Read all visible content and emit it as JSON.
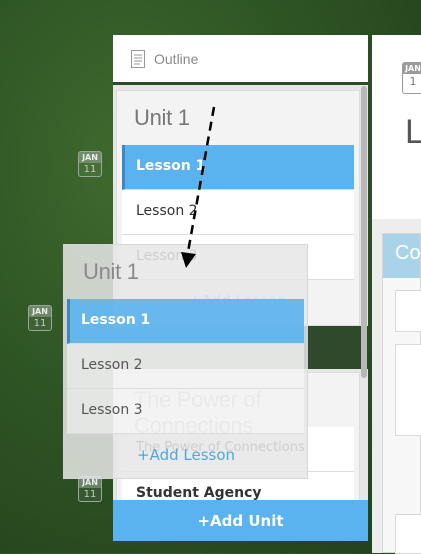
{
  "colors": {
    "accent": "#5ab3ee",
    "panel_bg": "#e6e6e6",
    "background": "#2e5424"
  },
  "date_badges": [
    {
      "month": "JAN",
      "day": "11"
    },
    {
      "month": "JAN",
      "day": "11"
    },
    {
      "month": "JAN",
      "day": "11"
    }
  ],
  "outline": {
    "icon": "document-icon",
    "header_label": "Outline",
    "units": [
      {
        "title": "Unit 1",
        "lessons": [
          "Lesson 1",
          "Lesson 2",
          "Lesson 3"
        ],
        "add_lesson_label": "+Add Lesson"
      },
      {
        "title": "The Power of Connections",
        "lessons": [
          "The Power of Connections",
          "Student Agency"
        ]
      }
    ],
    "add_unit_label": "+Add Unit"
  },
  "dragged_unit": {
    "title": "Unit 1",
    "lessons": [
      "Lesson 1",
      "Lesson 2",
      "Lesson 3"
    ],
    "add_lesson_label": "+Add Lesson"
  },
  "right_panel": {
    "badge_month": "JAN",
    "badge_day": "1",
    "title_fragment": "L",
    "course_header_fragment": "Cou"
  }
}
